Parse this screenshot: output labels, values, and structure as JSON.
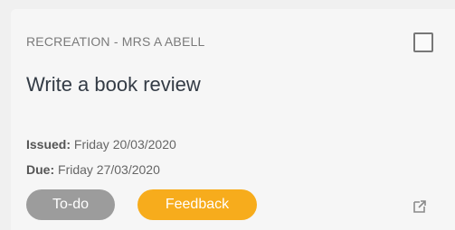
{
  "card": {
    "course": "RECREATION - MRS A ABELL",
    "title": "Write a book review",
    "issued_label": "Issued:",
    "issued_value": "Friday 20/03/2020",
    "due_label": "Due:",
    "due_value": "Friday 27/03/2020",
    "status_badge": "To-do",
    "feedback_badge": "Feedback",
    "checkbox_checked": false,
    "icons": {
      "checkbox": "checkbox-icon",
      "open": "open-external-icon"
    },
    "colors": {
      "todo": "#9c9c9c",
      "feedback": "#f7ac1c"
    }
  }
}
